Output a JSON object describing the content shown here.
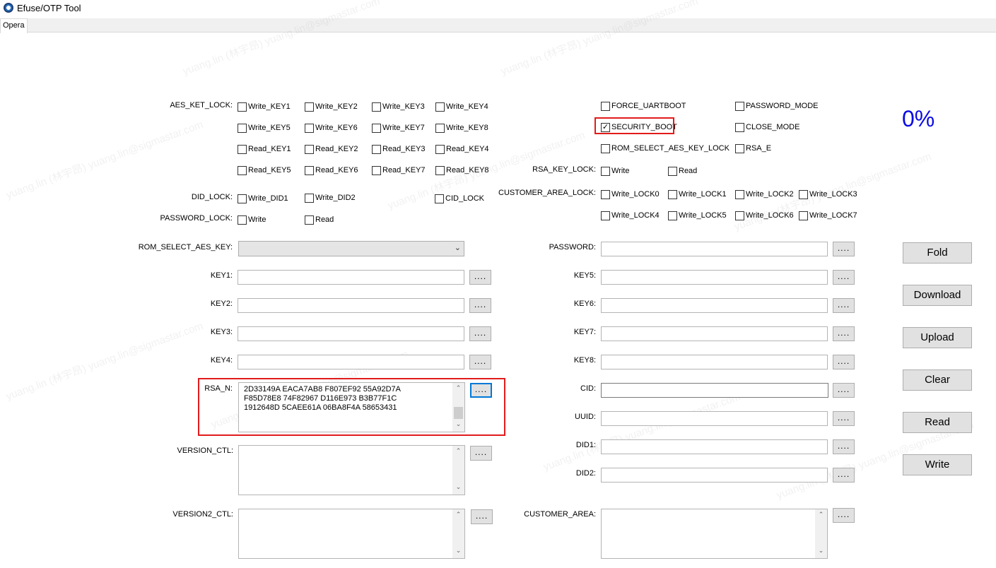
{
  "window": {
    "title": "Efuse/OTP Tool",
    "tab": "Opera"
  },
  "progress": {
    "percent_text": "0%",
    "value": 0,
    "color": "#0a0ae6"
  },
  "labels": {
    "aes_ket_lock": "AES_KET_LOCK:",
    "did_lock": "DID_LOCK:",
    "password_lock": "PASSWORD_LOCK:",
    "rom_select_aes_key": "ROM_SELECT_AES_KEY:",
    "key1": "KEY1:",
    "key2": "KEY2:",
    "key3": "KEY3:",
    "key4": "KEY4:",
    "rsa_n": "RSA_N:",
    "version_ctl": "VERSION_CTL:",
    "version2_ctl": "VERSION2_CTL:",
    "rsa_key_lock": "RSA_KEY_LOCK:",
    "customer_area_lock": "CUSTOMER_AREA_LOCK:",
    "password": "PASSWORD:",
    "key5": "KEY5:",
    "key6": "KEY6:",
    "key7": "KEY7:",
    "key8": "KEY8:",
    "cid": "CID:",
    "uuid": "UUID:",
    "did1": "DID1:",
    "did2": "DID2:",
    "customer_area": "CUSTOMER_AREA:"
  },
  "checkboxes": {
    "write_key1": "Write_KEY1",
    "write_key2": "Write_KEY2",
    "write_key3": "Write_KEY3",
    "write_key4": "Write_KEY4",
    "write_key5": "Write_KEY5",
    "write_key6": "Write_KEY6",
    "write_key7": "Write_KEY7",
    "write_key8": "Write_KEY8",
    "read_key1": "Read_KEY1",
    "read_key2": "Read_KEY2",
    "read_key3": "Read_KEY3",
    "read_key4": "Read_KEY4",
    "read_key5": "Read_KEY5",
    "read_key6": "Read_KEY6",
    "read_key7": "Read_KEY7",
    "read_key8": "Read_KEY8",
    "write_did1": "Write_DID1",
    "write_did2": "Write_DID2",
    "cid_lock": "CID_LOCK",
    "pw_write": "Write",
    "pw_read": "Read",
    "force_uartboot": "FORCE_UARTBOOT",
    "password_mode": "PASSWORD_MODE",
    "security_boot": "SECURITY_BOOT",
    "close_mode": "CLOSE_MODE",
    "rom_select_aes_key_lock": "ROM_SELECT_AES_KEY_LOCK",
    "rsa_e": "RSA_E",
    "rsa_write": "Write",
    "rsa_read": "Read",
    "write_lock0": "Write_LOCK0",
    "write_lock1": "Write_LOCK1",
    "write_lock2": "Write_LOCK2",
    "write_lock3": "Write_LOCK3",
    "write_lock4": "Write_LOCK4",
    "write_lock5": "Write_LOCK5",
    "write_lock6": "Write_LOCK6",
    "write_lock7": "Write_LOCK7"
  },
  "checked": {
    "security_boot": "✓"
  },
  "browse_label": "....",
  "rsa_n_value": "2D33149A EACA7AB8 F807EF92 55A92D7A\nF85D78E8 74F82967 D116E973 B3B77F1C\n1912648D 5CAEE61A 06BA8F4A 58653431",
  "side_buttons": {
    "fold": "Fold",
    "download": "Download",
    "upload": "Upload",
    "clear": "Clear",
    "read": "Read",
    "write": "Write"
  },
  "watermark": "yuang.lin (林宇昂) yuang.lin@sigmastar.com",
  "highlight_color": "#e21b1b"
}
